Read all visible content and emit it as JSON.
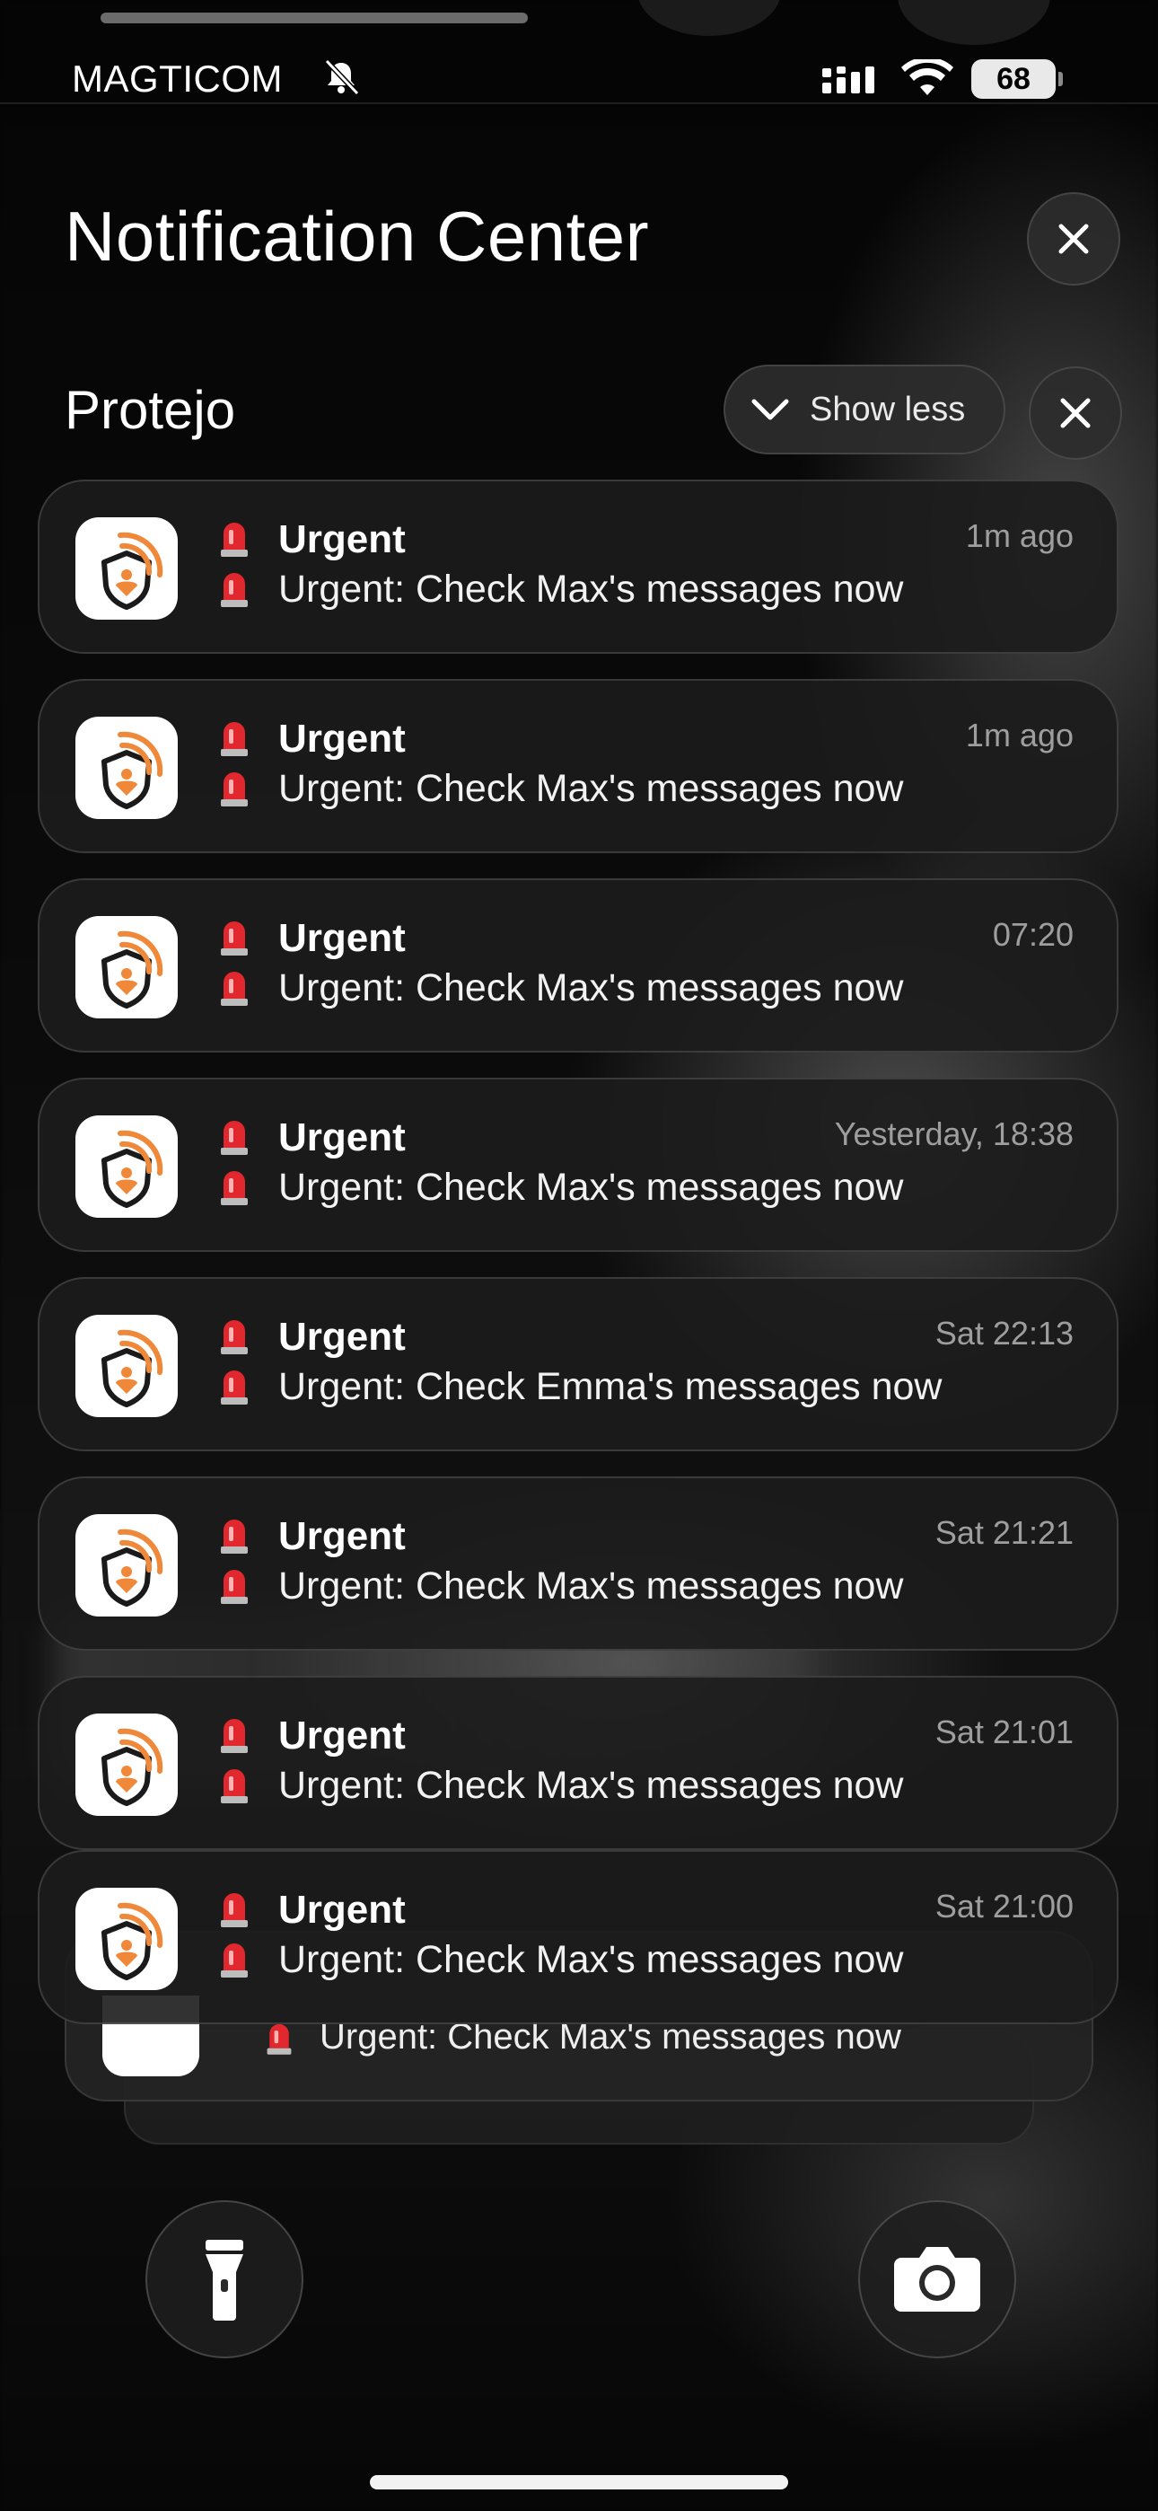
{
  "status_bar": {
    "carrier": "MAGTICOM",
    "battery": "68"
  },
  "header": {
    "title": "Notification Center"
  },
  "group": {
    "app_name": "Protejo",
    "show_less_label": "Show less"
  },
  "notifications": [
    {
      "title": "Urgent",
      "body": "Urgent: Check Max's messages now",
      "time": "1m ago"
    },
    {
      "title": "Urgent",
      "body": "Urgent: Check Max's messages now",
      "time": "1m ago"
    },
    {
      "title": "Urgent",
      "body": "Urgent: Check Max's messages now",
      "time": "07:20"
    },
    {
      "title": "Urgent",
      "body": "Urgent: Check Max's messages now",
      "time": "Yesterday, 18:38"
    },
    {
      "title": "Urgent",
      "body": "Urgent: Check Emma's messages now",
      "time": "Sat 22:13"
    },
    {
      "title": "Urgent",
      "body": "Urgent: Check Max's messages now",
      "time": "Sat 21:21"
    },
    {
      "title": "Urgent",
      "body": "Urgent: Check Max's messages now",
      "time": "Sat 21:01"
    },
    {
      "title": "Urgent",
      "body": "Urgent: Check Max's messages now",
      "time": "Sat 21:00"
    }
  ],
  "stacked_card": {
    "body": "Urgent: Check Max's messages now"
  },
  "icons": {
    "app_icon": "protejo-shield-icon",
    "siren": "siren-emoji-icon",
    "flashlight": "flashlight-icon",
    "camera": "camera-icon"
  },
  "colors": {
    "accent_orange": "#F0883A",
    "siren_red": "#E0282E"
  }
}
